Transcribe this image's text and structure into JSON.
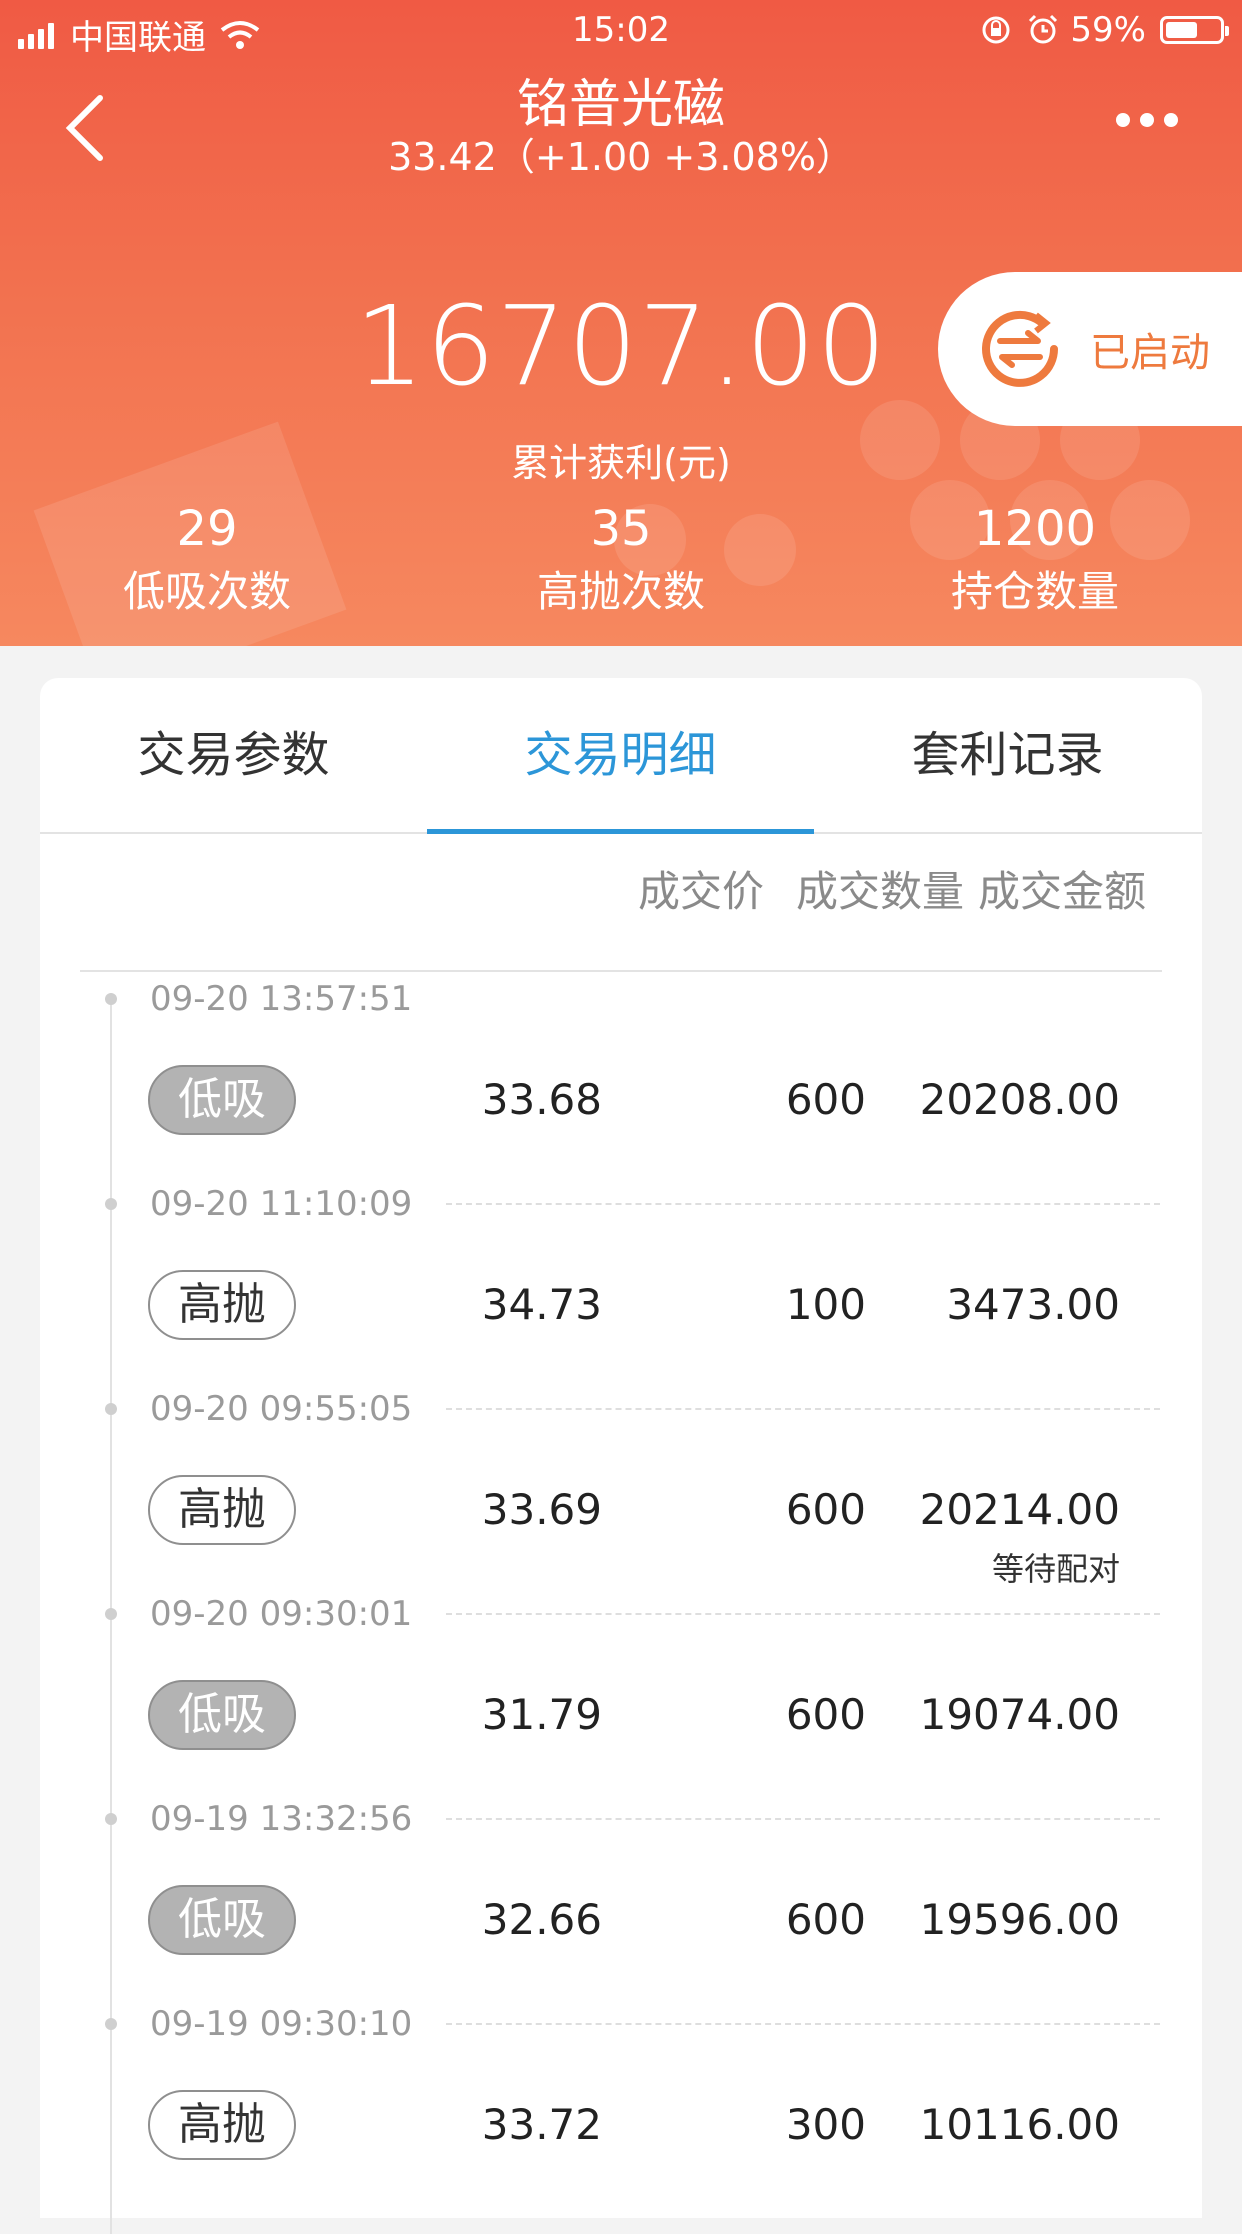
{
  "status_bar": {
    "carrier": "中国联通",
    "time": "15:02",
    "battery_percent": "59%",
    "battery_level": 0.59
  },
  "nav": {
    "title": "铭普光磁",
    "subtitle": "33.42（+1.00  +3.08%）"
  },
  "summary": {
    "profit": "16707.00",
    "profit_label": "累计获利(元)",
    "status_label": "已启动",
    "stats": [
      {
        "value": "29",
        "label": "低吸次数"
      },
      {
        "value": "35",
        "label": "高抛次数"
      },
      {
        "value": "1200",
        "label": "持仓数量"
      }
    ]
  },
  "tabs": [
    "交易参数",
    "交易明细",
    "套利记录"
  ],
  "active_tab": 1,
  "table": {
    "headers": {
      "price": "成交价",
      "qty": "成交数量",
      "amount": "成交金额"
    },
    "rows": [
      {
        "time": "09-20 13:57:51",
        "type": "低吸",
        "kind": "buy",
        "price": "33.68",
        "qty": "600",
        "amount": "20208.00",
        "note": ""
      },
      {
        "time": "09-20 11:10:09",
        "type": "高抛",
        "kind": "sell",
        "price": "34.73",
        "qty": "100",
        "amount": "3473.00",
        "note": ""
      },
      {
        "time": "09-20 09:55:05",
        "type": "高抛",
        "kind": "sell",
        "price": "33.69",
        "qty": "600",
        "amount": "20214.00",
        "note": "等待配对"
      },
      {
        "time": "09-20 09:30:01",
        "type": "低吸",
        "kind": "buy",
        "price": "31.79",
        "qty": "600",
        "amount": "19074.00",
        "note": ""
      },
      {
        "time": "09-19 13:32:56",
        "type": "低吸",
        "kind": "buy",
        "price": "32.66",
        "qty": "600",
        "amount": "19596.00",
        "note": ""
      },
      {
        "time": "09-19 09:30:10",
        "type": "高抛",
        "kind": "sell",
        "price": "33.72",
        "qty": "300",
        "amount": "10116.00",
        "note": ""
      }
    ]
  },
  "colors": {
    "header_top": "#f05a44",
    "header_bottom": "#f6885f",
    "accent_blue": "#2c96d8",
    "status_orange": "#ee7a3e"
  }
}
